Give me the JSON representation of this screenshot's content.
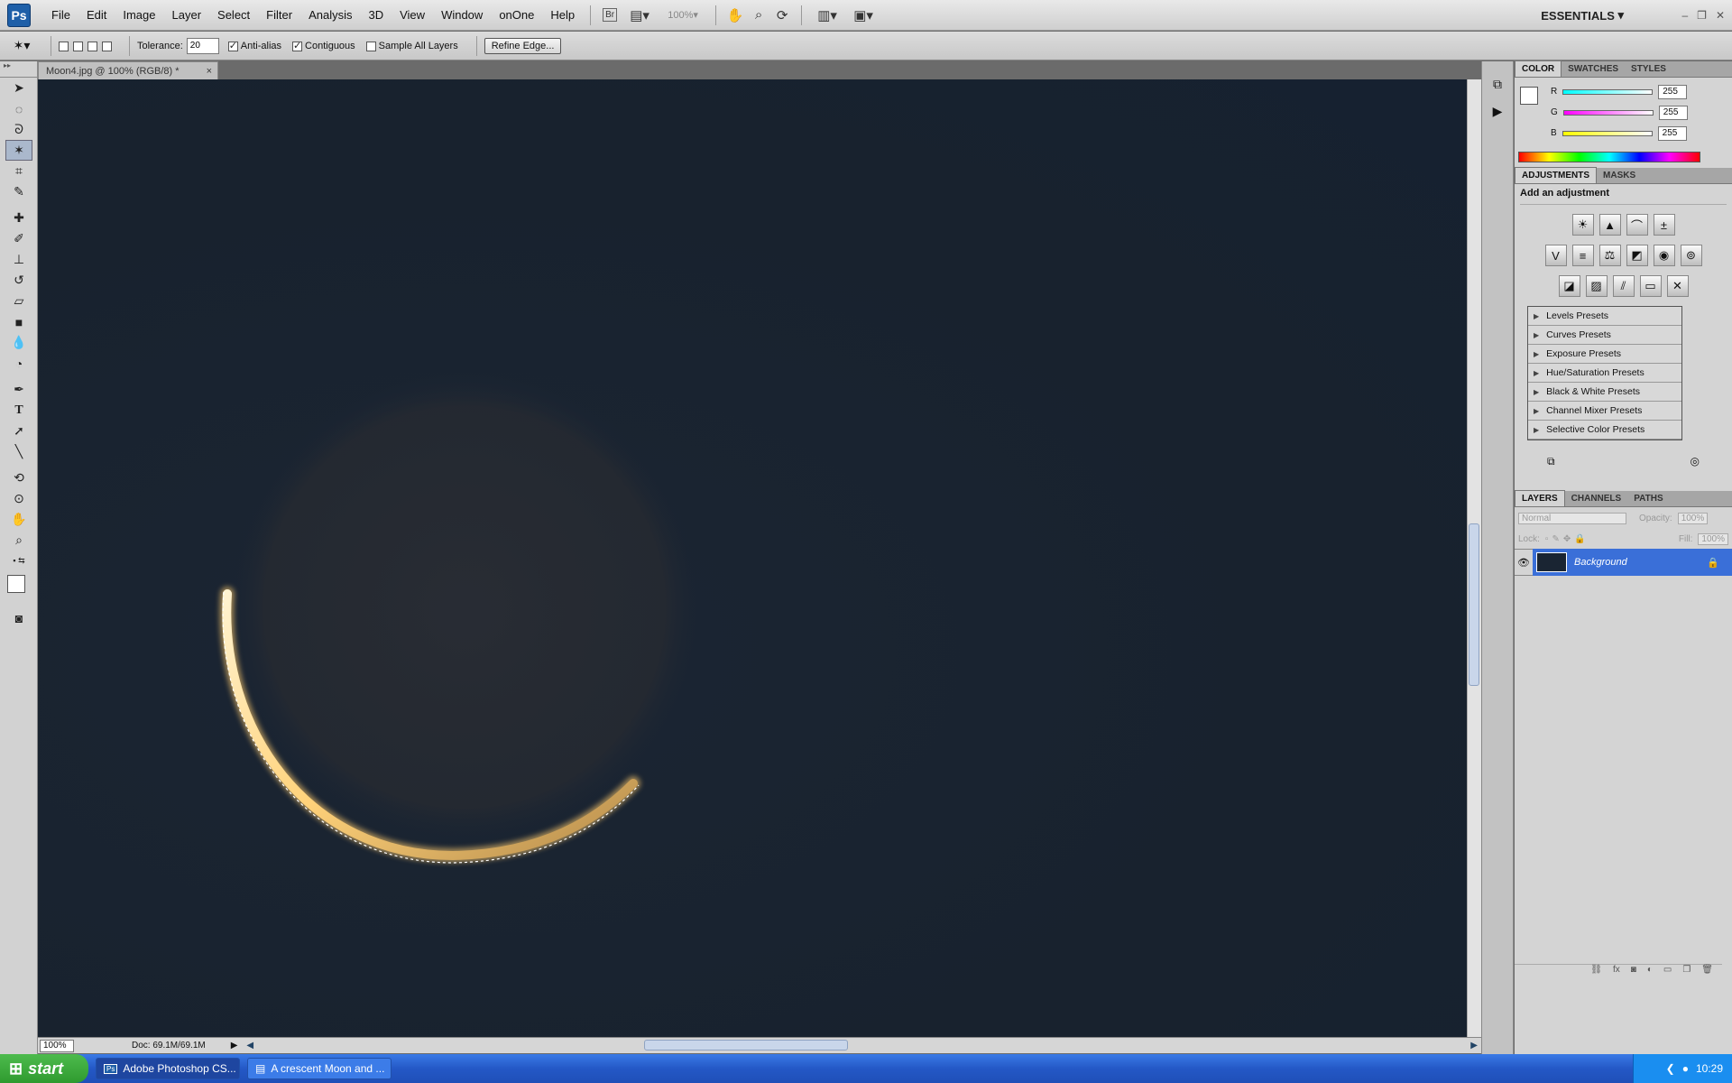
{
  "app": {
    "logo": "Ps"
  },
  "menu": [
    "File",
    "Edit",
    "Image",
    "Layer",
    "Select",
    "Filter",
    "Analysis",
    "3D",
    "View",
    "Window",
    "onOne",
    "Help"
  ],
  "appbar": {
    "bridge": "Br",
    "zoom": "100%",
    "workspace": "ESSENTIALS"
  },
  "options": {
    "tolerance_label": "Tolerance:",
    "tolerance_value": "20",
    "anti_alias": "Anti-alias",
    "contiguous": "Contiguous",
    "sample_all": "Sample All Layers",
    "refine_edge": "Refine Edge..."
  },
  "document": {
    "tab_title": "Moon4.jpg @ 100% (RGB/8) *"
  },
  "status": {
    "zoom": "100%",
    "doc": "Doc: 69.1M/69.1M"
  },
  "color_panel": {
    "tabs": [
      "COLOR",
      "SWATCHES",
      "STYLES"
    ],
    "channels": [
      {
        "name": "R",
        "value": "255"
      },
      {
        "name": "G",
        "value": "255"
      },
      {
        "name": "B",
        "value": "255"
      }
    ]
  },
  "adjust_panel": {
    "tabs": [
      "ADJUSTMENTS",
      "MASKS"
    ],
    "heading": "Add an adjustment",
    "presets": [
      "Levels Presets",
      "Curves Presets",
      "Exposure Presets",
      "Hue/Saturation Presets",
      "Black & White Presets",
      "Channel Mixer Presets",
      "Selective Color Presets"
    ]
  },
  "layers_panel": {
    "tabs": [
      "LAYERS",
      "CHANNELS",
      "PATHS"
    ],
    "blend_mode": "Normal",
    "opacity_label": "Opacity:",
    "opacity_value": "100%",
    "lock_label": "Lock:",
    "fill_label": "Fill:",
    "fill_value": "100%",
    "layer_name": "Background"
  },
  "taskbar": {
    "start": "start",
    "tasks": [
      "Adobe Photoshop CS...",
      "A crescent Moon and ..."
    ],
    "clock": "10:29"
  },
  "colors": {
    "selection_blue": "#3a6fd8",
    "canvas": "#18222e"
  }
}
